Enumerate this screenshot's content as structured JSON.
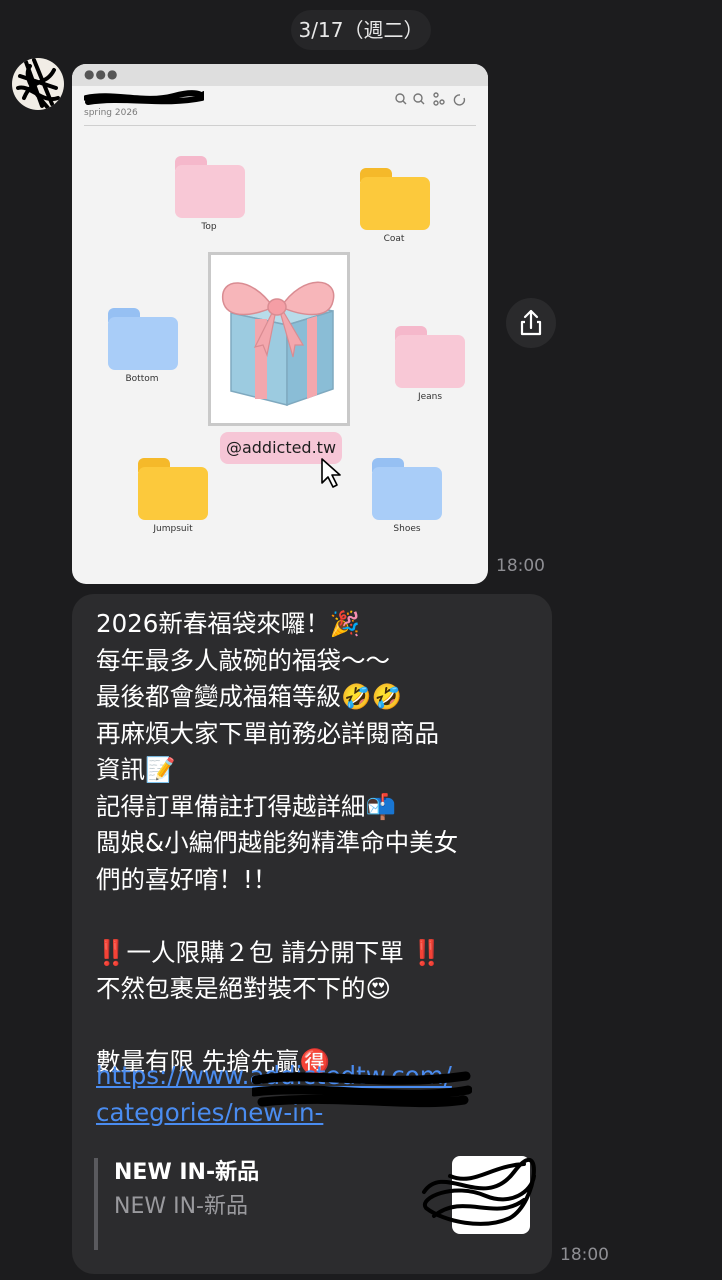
{
  "header": {
    "date": "3/17（週二）"
  },
  "image_message": {
    "doc_subtitle": "spring 2026",
    "folders": {
      "top": "Top",
      "coat": "Coat",
      "bottom": "Bottom",
      "jeans": "Jeans",
      "jumpsuit": "Jumpsuit",
      "shoes": "Shoes"
    },
    "handle": "@addicted.tw",
    "time": "18:00"
  },
  "text_message": {
    "lines": "2026新春福袋來囉！🎉\n每年最多人敲碗的福袋～～\n最後都會變成福箱等級🤣🤣\n再麻煩大家下單前務必詳閱商品\n資訊📝\n記得訂單備註打得越詳細📬\n闆娘&小編們越能夠精準命中美女\n們的喜好唷！!！\n\n‼️一人限購２包 請分開下單 ‼️\n不然包裹是絕對裝不下的😍\n\n數量有限 先搶先贏🉐",
    "link": "https://www.addictedtw.com/\ncategories/new-in-",
    "preview_title": "NEW IN-新品",
    "preview_description": "NEW IN-新品",
    "time": "18:00"
  },
  "colors": {
    "background": "#1c1c1e",
    "bubble": "#2c2c2e",
    "link": "#4a8cf0",
    "timestamp": "#8e8e93",
    "folder_pink": "#f8c8d6",
    "folder_yellow": "#fcc93c",
    "folder_blue": "#a9cdf8"
  }
}
